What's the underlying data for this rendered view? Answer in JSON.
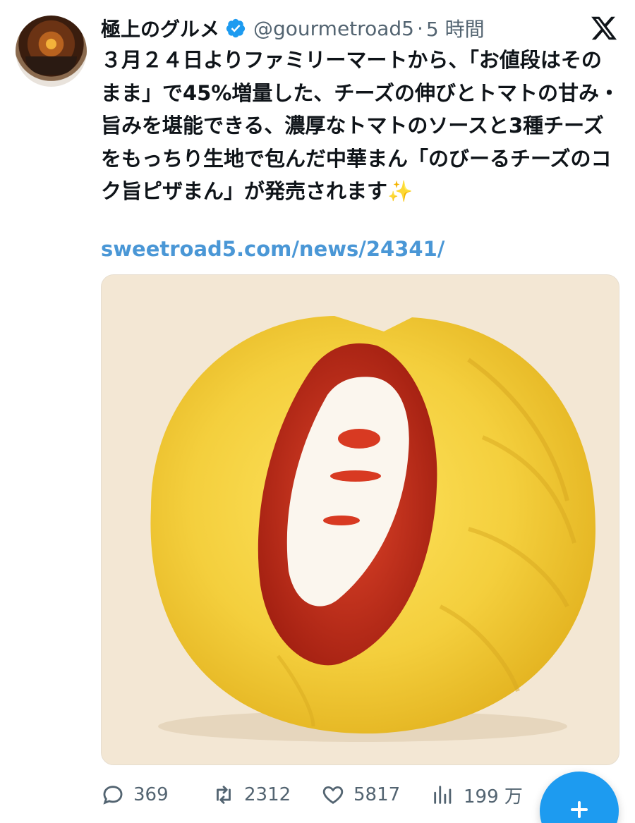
{
  "tweet": {
    "display_name": "極上のグルメ",
    "handle": "@gourmetroad5",
    "separator": "·",
    "time": "5 時間",
    "text": "３月２４日よりファミリーマートから、「お値段はそのまま」で45%増量した、チーズの伸びとトマトの甘み・旨みを堪能できる、濃厚なトマトのソースと3種チーズをもっちり生地で包んだ中華まん「のびーるチーズのコク旨ピザまん」が発売されます",
    "emoji": "✨",
    "link": "sweetroad5.com/news/24341/"
  },
  "metrics": {
    "replies": "369",
    "retweets": "2312",
    "likes": "5817",
    "views": "199 万"
  },
  "icons": {
    "avatar": "avatar",
    "verified": "verified-badge-icon",
    "x_logo": "x-logo-icon",
    "reply": "reply-icon",
    "retweet": "retweet-icon",
    "like": "heart-icon",
    "views": "views-icon",
    "compose": "plus-icon"
  },
  "colors": {
    "accent": "#1d9bf0",
    "link": "#4a97d6",
    "secondary_text": "#536471",
    "verified": "#1d9bf0"
  }
}
